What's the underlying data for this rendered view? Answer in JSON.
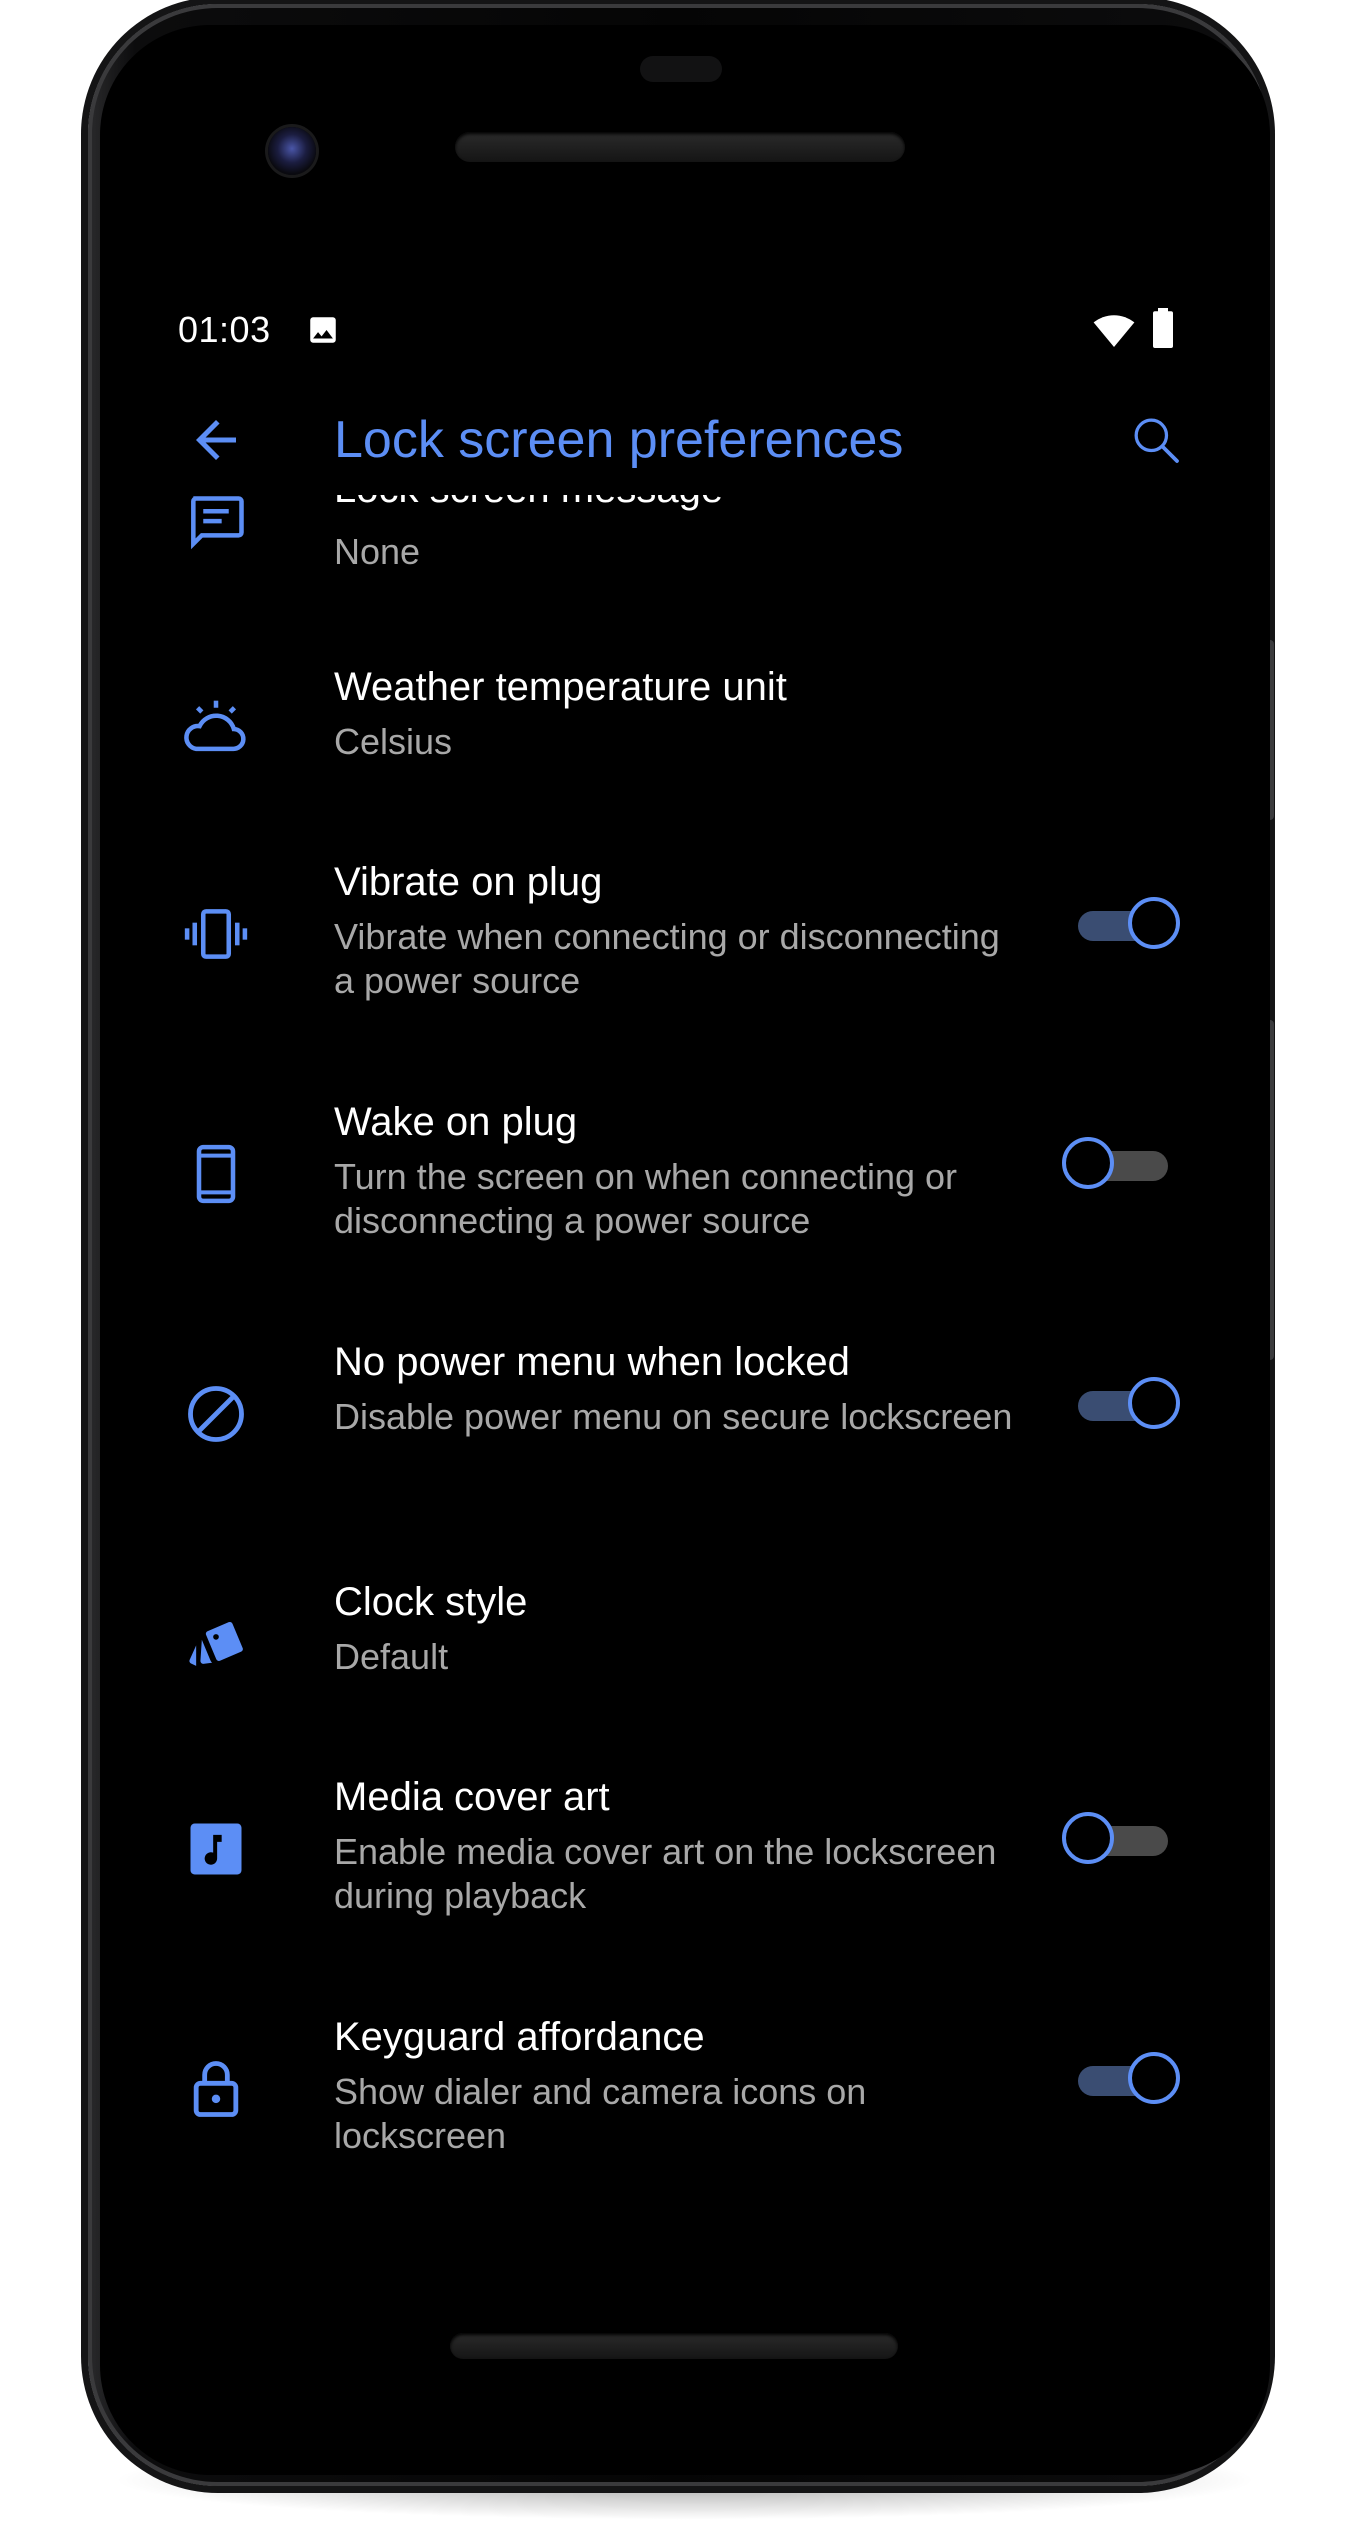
{
  "status_bar": {
    "time": "01:03",
    "icons": [
      "image-notification-icon",
      "wifi-icon",
      "battery-icon"
    ]
  },
  "toolbar": {
    "back_icon": "arrow-back-icon",
    "title": "Lock screen preferences",
    "search_icon": "search-icon"
  },
  "colors": {
    "accent": "#5c8ef5",
    "background": "#000000",
    "title_text": "#ffffff",
    "summary_text": "#a8a8a8"
  },
  "settings": [
    {
      "icon": "message-icon",
      "title": "Lock screen message",
      "summary": "None",
      "toggle": null
    },
    {
      "icon": "weather-icon",
      "title": "Weather temperature unit",
      "summary": "Celsius",
      "toggle": null
    },
    {
      "icon": "vibrate-icon",
      "title": "Vibrate on plug",
      "summary": "Vibrate when connecting or disconnecting a power source",
      "toggle": true
    },
    {
      "icon": "phone-screen-icon",
      "title": "Wake on plug",
      "summary": "Turn the screen on when connecting or disconnecting a power source",
      "toggle": false
    },
    {
      "icon": "block-icon",
      "title": "No power menu when locked",
      "summary": "Disable power menu on secure lockscreen",
      "toggle": true
    },
    {
      "icon": "style-icon",
      "title": "Clock style",
      "summary": "Default",
      "toggle": null
    },
    {
      "icon": "music-note-icon",
      "title": "Media cover art",
      "summary": "Enable media cover art on the lockscreen during playback",
      "toggle": false
    },
    {
      "icon": "lock-icon",
      "title": "Keyguard affordance",
      "summary": "Show dialer and camera icons on lockscreen",
      "toggle": true
    }
  ]
}
